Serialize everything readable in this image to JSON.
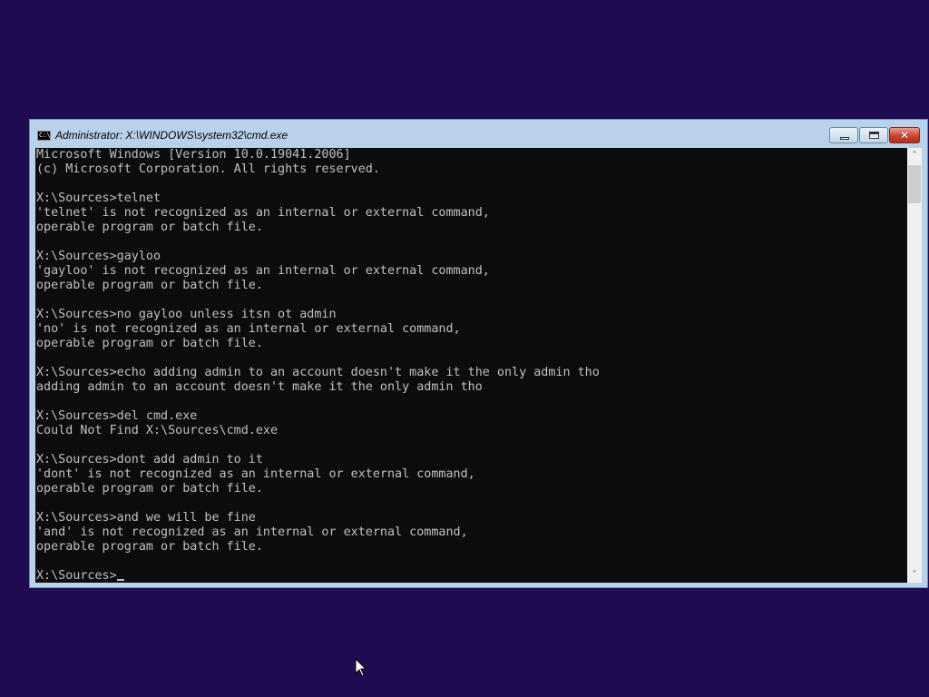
{
  "window": {
    "title": "Administrator: X:\\WINDOWS\\system32\\cmd.exe",
    "icon": "console-icon",
    "icon_text": "C:\\",
    "controls": {
      "minimize_icon": "minimize-icon",
      "maximize_icon": "maximize-icon",
      "close_label": "✕"
    }
  },
  "console": {
    "lines": [
      "Microsoft Windows [Version 10.0.19041.2006]",
      "(c) Microsoft Corporation. All rights reserved.",
      "",
      "X:\\Sources>telnet",
      "'telnet' is not recognized as an internal or external command,",
      "operable program or batch file.",
      "",
      "X:\\Sources>gayloo",
      "'gayloo' is not recognized as an internal or external command,",
      "operable program or batch file.",
      "",
      "X:\\Sources>no gayloo unless itsn ot admin",
      "'no' is not recognized as an internal or external command,",
      "operable program or batch file.",
      "",
      "X:\\Sources>echo adding admin to an account doesn't make it the only admin tho",
      "adding admin to an account doesn't make it the only admin tho",
      "",
      "X:\\Sources>del cmd.exe",
      "Could Not Find X:\\Sources\\cmd.exe",
      "",
      "X:\\Sources>dont add admin to it",
      "'dont' is not recognized as an internal or external command,",
      "operable program or batch file.",
      "",
      "X:\\Sources>and we will be fine",
      "'and' is not recognized as an internal or external command,",
      "operable program or batch file.",
      ""
    ],
    "prompt": "X:\\Sources>",
    "text_color": "#c0c0c0",
    "background_color": "#0c0c0c"
  },
  "scrollbar": {
    "up_glyph": "˄",
    "down_glyph": "˅"
  },
  "desktop": {
    "background_color": "#1f0b52",
    "pointer_icon": "mouse-pointer-icon"
  }
}
